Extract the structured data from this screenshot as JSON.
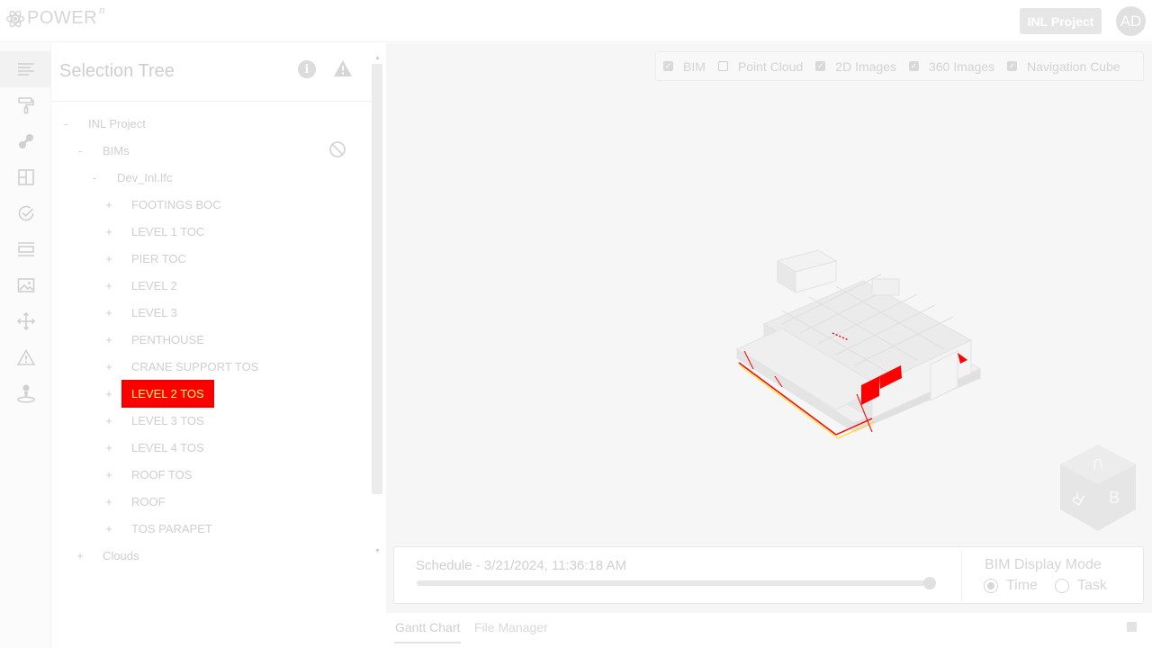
{
  "header": {
    "logo_text": "POWER",
    "logo_sup": "n",
    "project_button": "INL Project",
    "avatar_initials": "AD"
  },
  "rail": {
    "items": [
      "selection-tree-icon",
      "paint-roller-icon",
      "link-icon",
      "layout-grid-icon",
      "check-circle-icon",
      "dimension-icon",
      "image-icon",
      "move-icon",
      "warning-icon",
      "pin-location-icon"
    ]
  },
  "panel": {
    "title": "Selection Tree",
    "info_glyph": "i",
    "tree": {
      "root": {
        "toggle": "-",
        "label": "INL Project"
      },
      "bims": {
        "toggle": "-",
        "label": "BIMs"
      },
      "file": {
        "toggle": "-",
        "label": "Dev_Inl.Ifc"
      },
      "levels": [
        {
          "toggle": "+",
          "label": "FOOTINGS BOC"
        },
        {
          "toggle": "+",
          "label": "LEVEL 1 TOC"
        },
        {
          "toggle": "+",
          "label": "PIER TOC"
        },
        {
          "toggle": "+",
          "label": "LEVEL 2"
        },
        {
          "toggle": "+",
          "label": "LEVEL 3"
        },
        {
          "toggle": "+",
          "label": "PENTHOUSE"
        },
        {
          "toggle": "+",
          "label": "CRANE SUPPORT TOS"
        },
        {
          "toggle": "+",
          "label": "LEVEL 2 TOS",
          "selected": true
        },
        {
          "toggle": "+",
          "label": "LEVEL 3 TOS"
        },
        {
          "toggle": "+",
          "label": "LEVEL 4 TOS"
        },
        {
          "toggle": "+",
          "label": "ROOF TOS"
        },
        {
          "toggle": "+",
          "label": "ROOF"
        },
        {
          "toggle": "+",
          "label": "TOS PARAPET"
        }
      ],
      "clouds": {
        "toggle": "+",
        "label": "Clouds"
      }
    }
  },
  "viewer": {
    "visibility": [
      {
        "label": "BIM",
        "checked": true
      },
      {
        "label": "Point Cloud",
        "checked": false
      },
      {
        "label": "2D Images",
        "checked": true
      },
      {
        "label": "360 Images",
        "checked": true
      },
      {
        "label": "Navigation Cube",
        "checked": true
      }
    ],
    "navcube_faces": [
      "U",
      "R",
      "B"
    ],
    "highlight_color": "#ff0000"
  },
  "schedule": {
    "label": "Schedule - 3/21/2024, 11:36:18 AM",
    "progress": 1.0,
    "mode_title": "BIM Display Mode",
    "modes": [
      {
        "label": "Time",
        "selected": true
      },
      {
        "label": "Task",
        "selected": false
      }
    ]
  },
  "bottom_tabs": {
    "gantt": "Gantt Chart",
    "files": "File Manager"
  }
}
